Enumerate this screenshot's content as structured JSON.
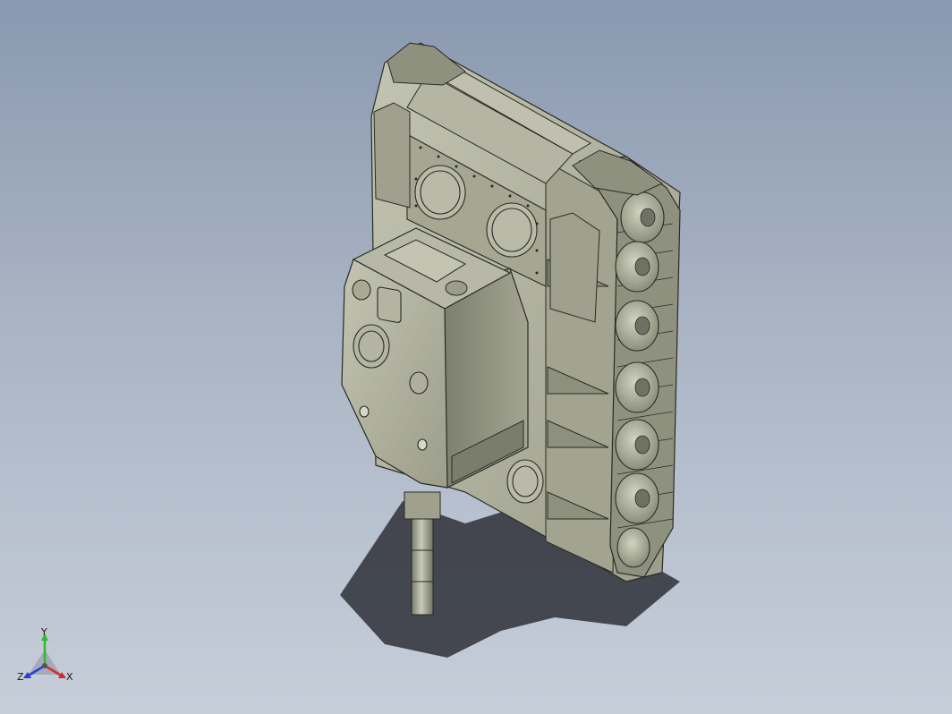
{
  "viewport": {
    "background_top": "#8a99b0",
    "background_bottom": "#c7ceda"
  },
  "model": {
    "subject": "tank-hull-assembly",
    "body_color": "#a8aa96",
    "shade_color": "#8e907e",
    "light_color": "#c3c5b2",
    "edge_color": "#2a2a24"
  },
  "orientation_triad": {
    "y_label": "Y",
    "x_label": "X",
    "z_label": "Z",
    "y_color": "#2db82d",
    "x_color": "#d42a2a",
    "z_color": "#2a3fd4"
  }
}
